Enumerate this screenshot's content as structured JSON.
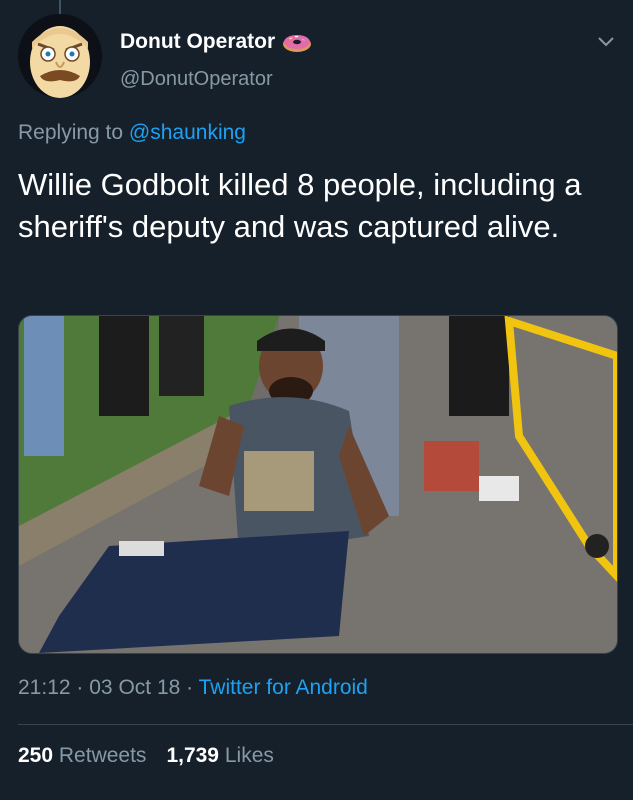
{
  "author": {
    "display_name": "Donut Operator",
    "handle": "@DonutOperator",
    "name_emoji": "donut"
  },
  "reply": {
    "prefix": "Replying to",
    "mention": "@shaunking"
  },
  "tweet": {
    "text": "Willie Godbolt killed 8 people, including a sheriff's deputy and was captured alive."
  },
  "meta": {
    "time": "21:12",
    "date": "03 Oct 18",
    "separator": "·",
    "source": "Twitter for Android"
  },
  "stats": {
    "retweets_count": "250",
    "retweets_label": "Retweets",
    "likes_count": "1,739",
    "likes_label": "Likes"
  },
  "colors": {
    "background": "#15202b",
    "secondary_text": "#8899a6",
    "link": "#1da1f2"
  }
}
